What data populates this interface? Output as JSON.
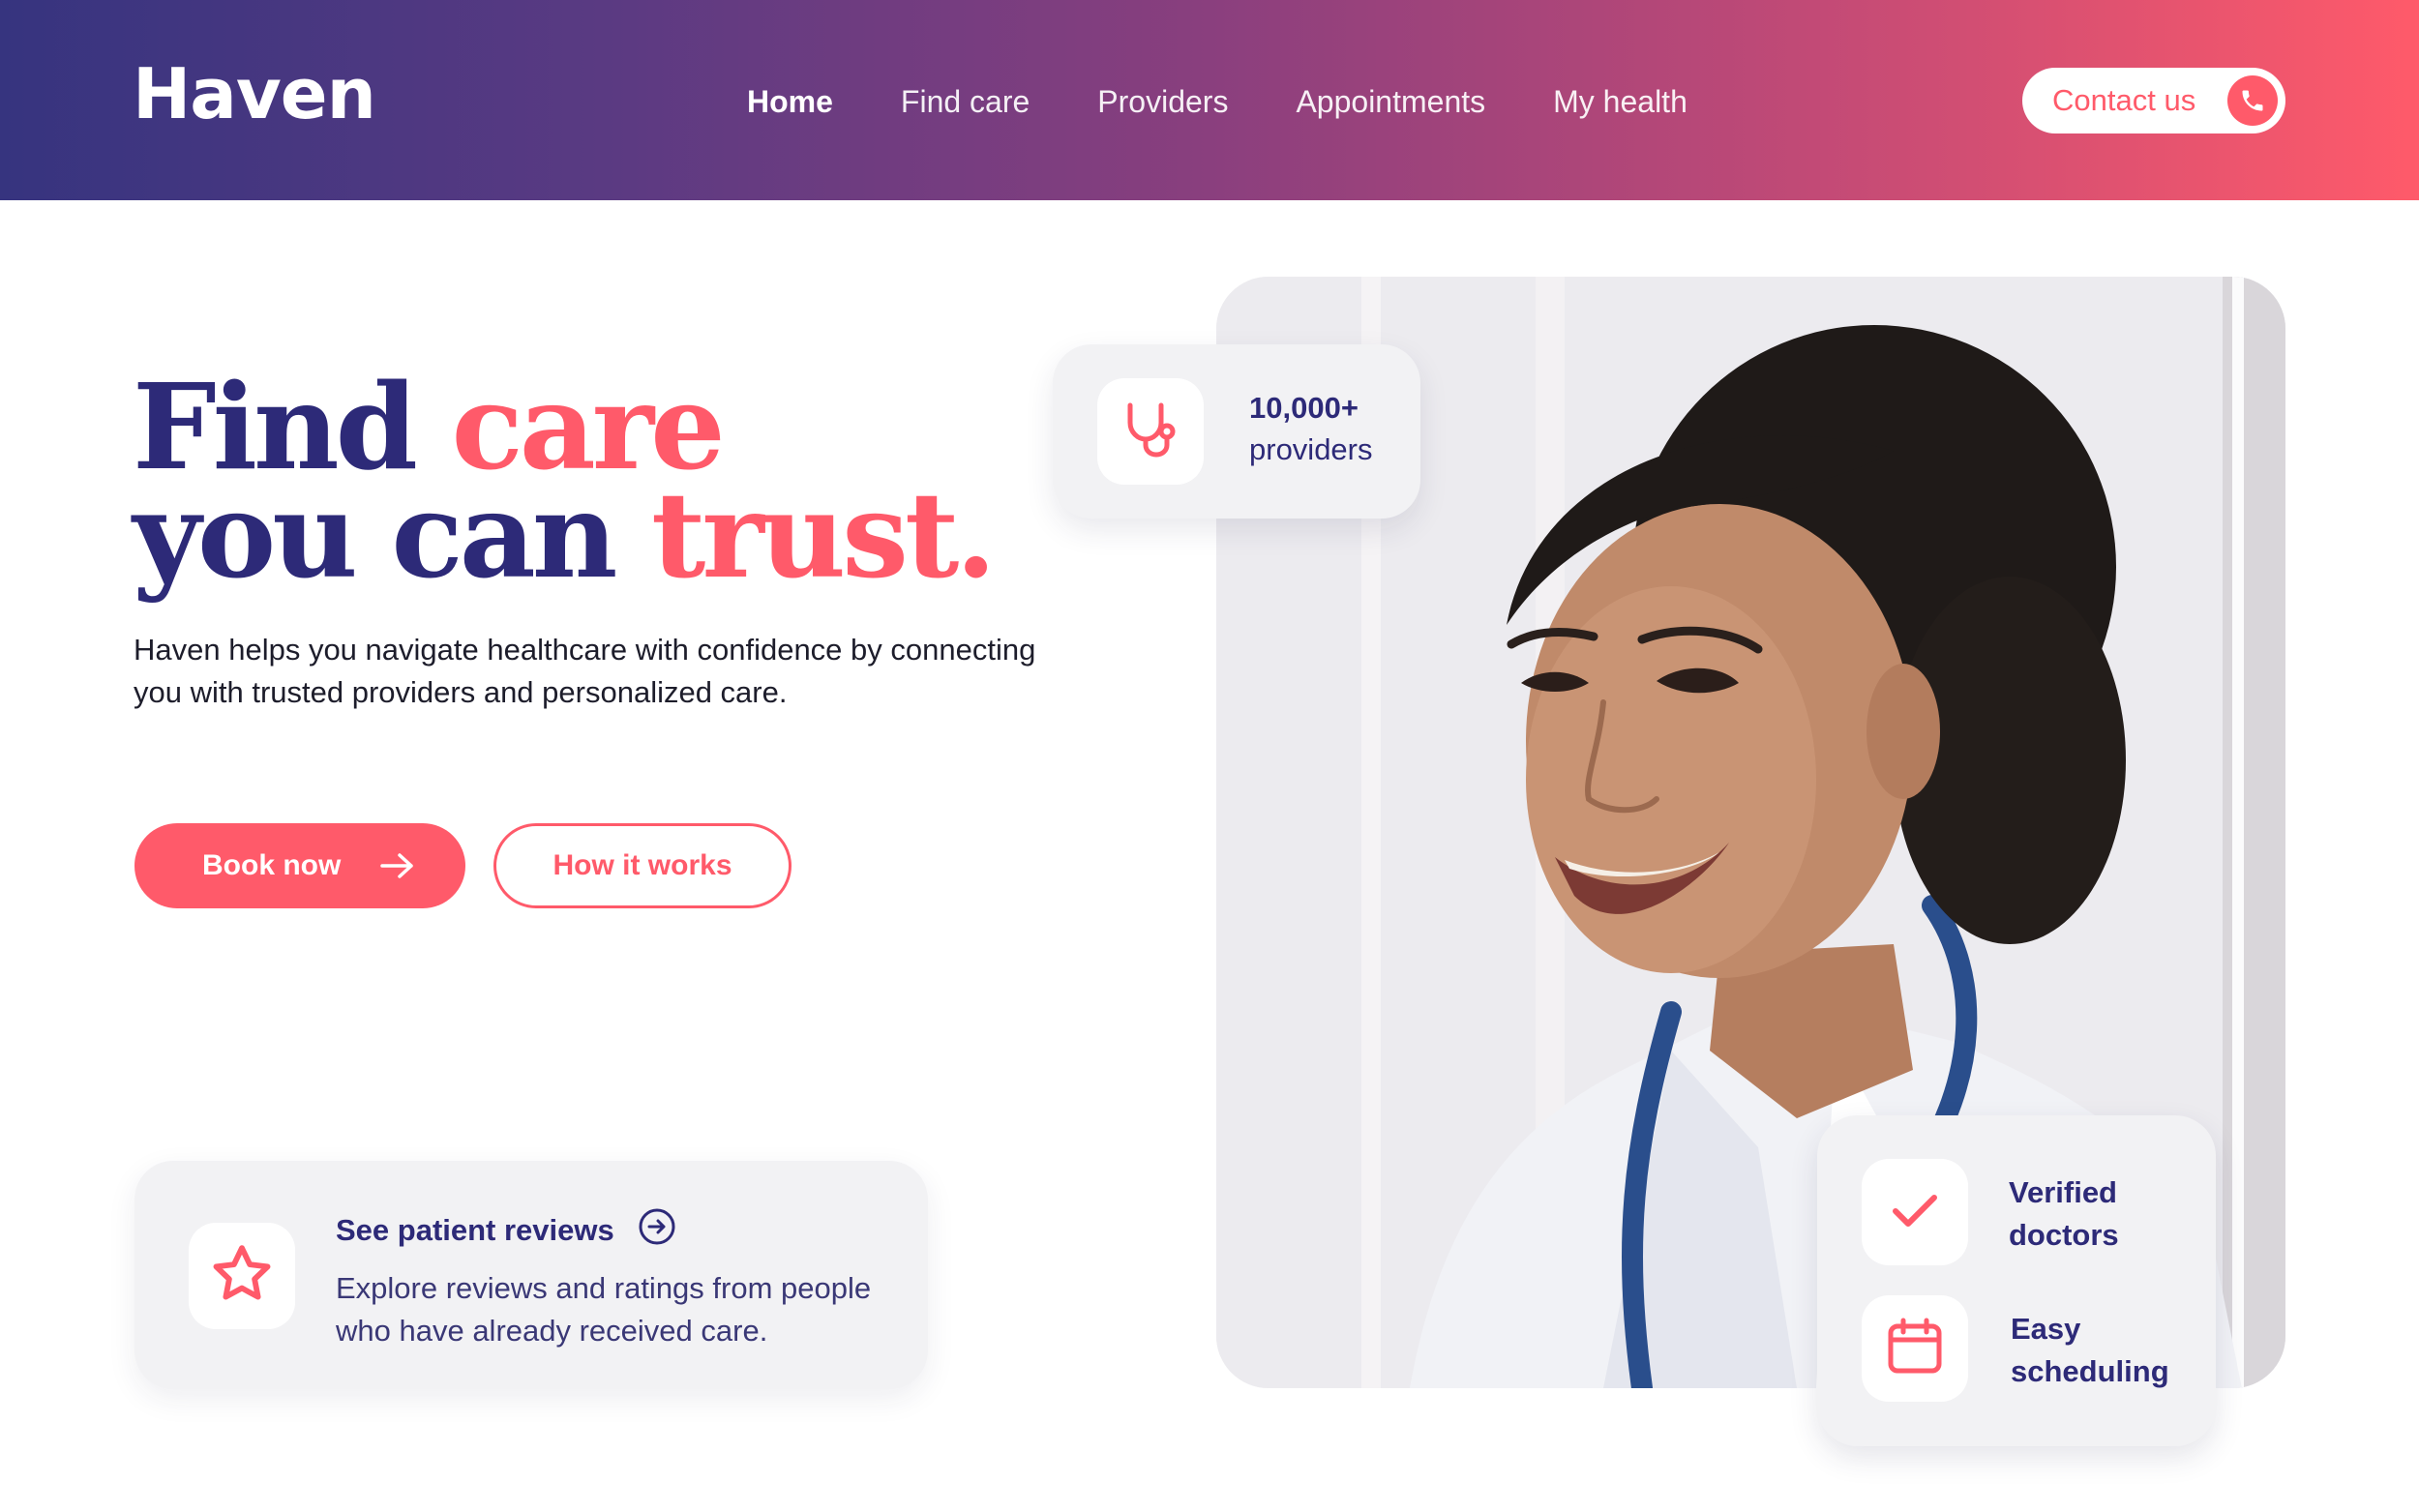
{
  "brand": {
    "name": "Haven"
  },
  "nav": {
    "items": [
      {
        "label": "Home",
        "active": true
      },
      {
        "label": "Find care",
        "active": false
      },
      {
        "label": "Providers",
        "active": false
      },
      {
        "label": "Appointments",
        "active": false
      },
      {
        "label": "My health",
        "active": false
      }
    ]
  },
  "header": {
    "contact_label": "Contact us",
    "contact_icon": "phone-icon"
  },
  "hero": {
    "headline_line1_a": "Find",
    "headline_line1_b": "care",
    "headline_line2_a": "you can",
    "headline_line2_b": "trust.",
    "subtext": "Haven helps you navigate healthcare with confidence by connecting you with trusted providers and personalized care.",
    "primary_cta": "Book now",
    "secondary_cta": "How it works"
  },
  "reviews_card": {
    "title": "See patient reviews",
    "description": "Explore reviews and ratings from people who have already received care.",
    "icon": "star-icon"
  },
  "providers_badge": {
    "count": "10,000+",
    "label": "providers",
    "icon": "stethoscope-icon"
  },
  "features_badge": {
    "items": [
      {
        "label": "Verified doctors",
        "icon": "check-icon"
      },
      {
        "label": "Easy scheduling",
        "icon": "calendar-icon"
      }
    ]
  },
  "colors": {
    "primary": "#2d2a78",
    "accent": "#ff5a6a",
    "gradient_start": "#36347f",
    "gradient_end": "#ff5a6a"
  }
}
